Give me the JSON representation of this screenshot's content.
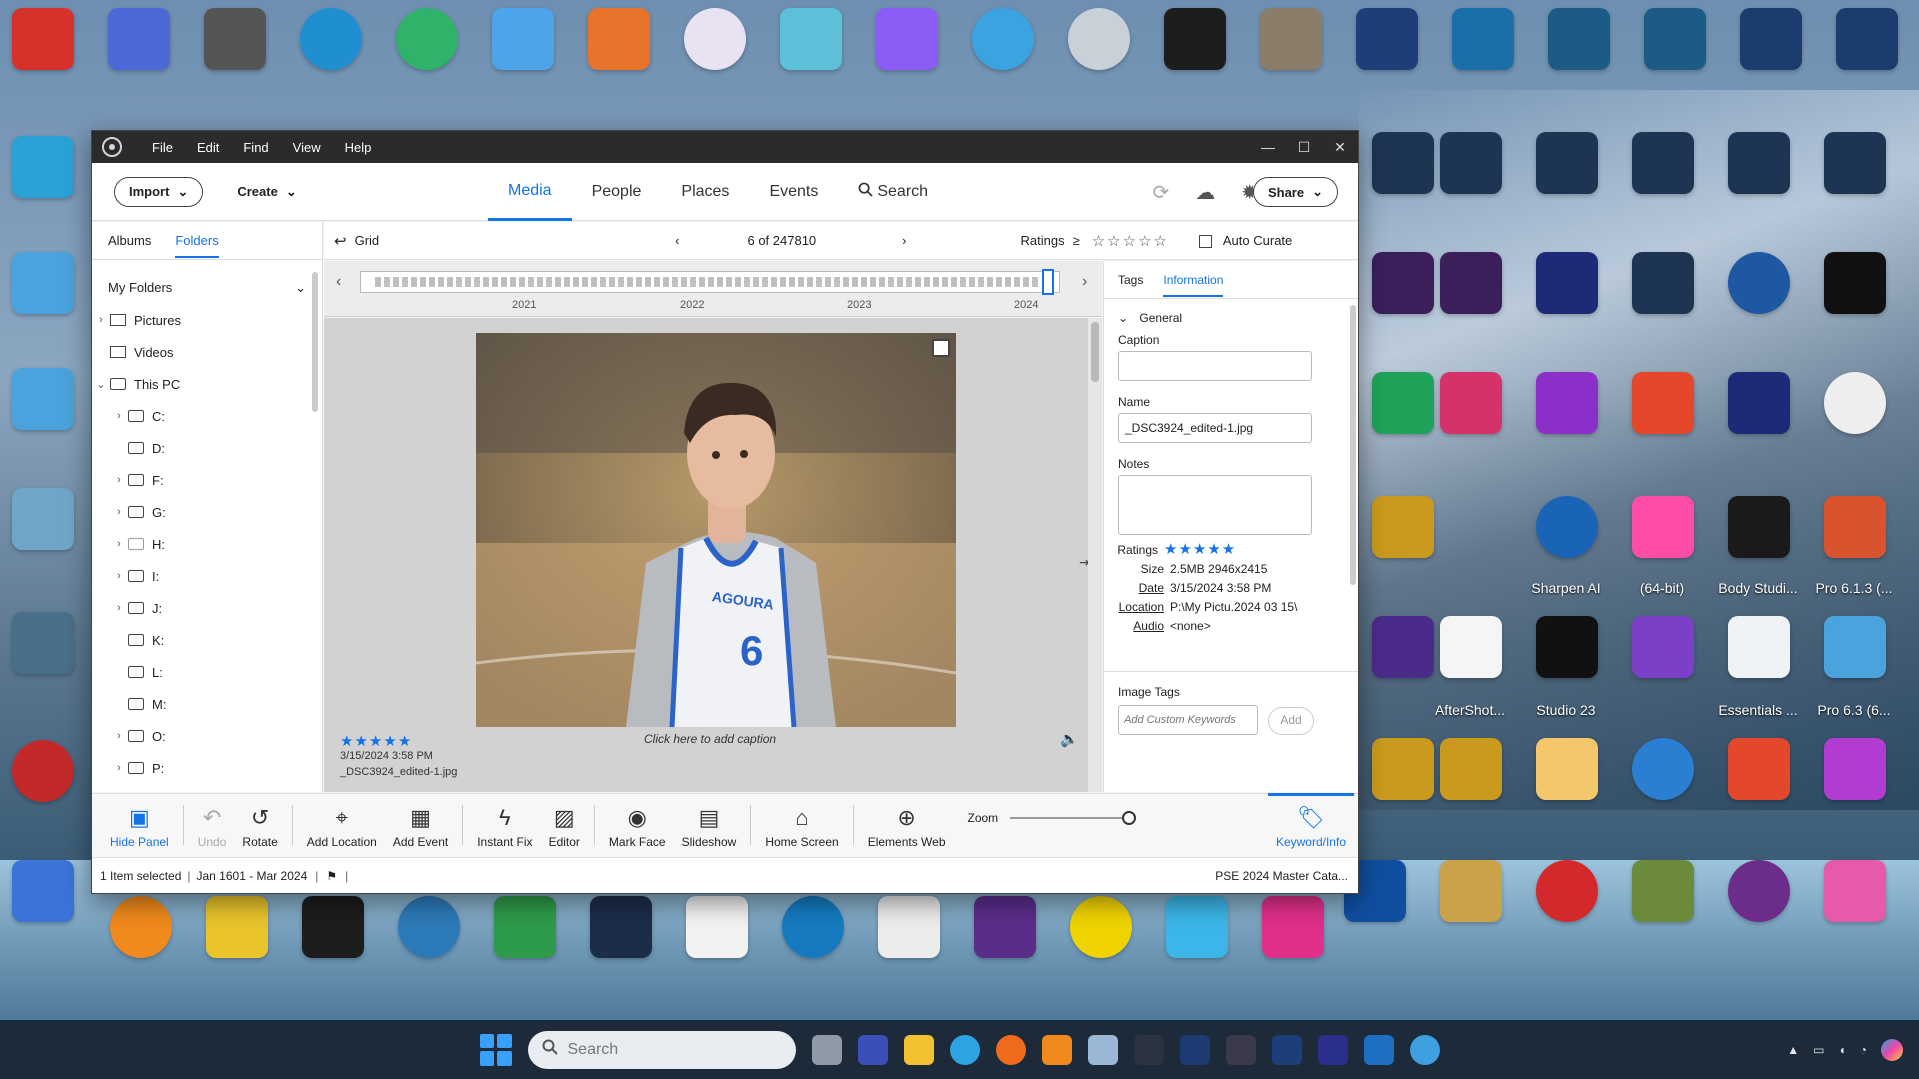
{
  "desktop": {
    "captions": [
      "Sharpen AI",
      "(64-bit)",
      "Body Studi...",
      "Pro 6.1.3 (...",
      "AfterShot...",
      "Studio 23",
      "Essentials ...",
      "Pro 6.3 (6..."
    ]
  },
  "taskbar": {
    "search_placeholder": "Search"
  },
  "window": {
    "menu": [
      "File",
      "Edit",
      "Find",
      "View",
      "Help"
    ],
    "import_label": "Import",
    "create_label": "Create",
    "tabs": [
      "Media",
      "People",
      "Places",
      "Events",
      "Search"
    ],
    "share_label": "Share"
  },
  "left_panel": {
    "tabs": [
      "Albums",
      "Folders"
    ],
    "section_title": "My Folders",
    "items": [
      "Pictures",
      "Videos",
      "This PC",
      "C:",
      "D:",
      "F:",
      "G:",
      "H:",
      "I:",
      "J:",
      "K:",
      "L:",
      "M:",
      "O:",
      "P:"
    ]
  },
  "viewbar": {
    "grid_label": "Grid",
    "counter": "6 of 247810",
    "ratings_label": "Ratings",
    "ratings_op": "≥",
    "auto_curate": "Auto Curate"
  },
  "timeline": {
    "years": [
      "2021",
      "2022",
      "2023",
      "2024"
    ]
  },
  "viewer": {
    "rating": 5,
    "date": "3/15/2024 3:58 PM",
    "filename": "_DSC3924_edited-1.jpg",
    "caption_hint": "Click here to add caption",
    "jersey_text": "AGOURA",
    "jersey_number": "6"
  },
  "info_panel": {
    "tabs": [
      "Tags",
      "Information"
    ],
    "section": "General",
    "caption_label": "Caption",
    "caption_value": "",
    "name_label": "Name",
    "name_value": "_DSC3924_edited-1.jpg",
    "notes_label": "Notes",
    "notes_value": "",
    "ratings_label": "Ratings",
    "rating": 5,
    "size_label": "Size",
    "size_value": "2.5MB  2946x2415",
    "date_label": "Date",
    "date_value": "3/15/2024 3:58 PM",
    "location_label": "Location",
    "location_value": "P:\\My Pictu.2024 03 15\\",
    "audio_label": "Audio",
    "audio_value": "<none>",
    "image_tags_label": "Image Tags",
    "keywords_placeholder": "Add Custom Keywords",
    "add_label": "Add"
  },
  "toolbar": {
    "hide_panel": "Hide Panel",
    "undo": "Undo",
    "rotate": "Rotate",
    "add_location": "Add Location",
    "add_event": "Add Event",
    "instant_fix": "Instant Fix",
    "editor": "Editor",
    "mark_face": "Mark Face",
    "slideshow": "Slideshow",
    "home_screen": "Home Screen",
    "elements_web": "Elements Web",
    "zoom": "Zoom",
    "zoom_level": 1.0,
    "keyword_info": "Keyword/Info"
  },
  "status": {
    "selection": "1 Item selected",
    "date_range": "Jan 1601 - Mar 2024",
    "catalog": "PSE 2024 Master Cata..."
  },
  "colors": {
    "accent": "#1473e6",
    "star": "#1473e6"
  }
}
